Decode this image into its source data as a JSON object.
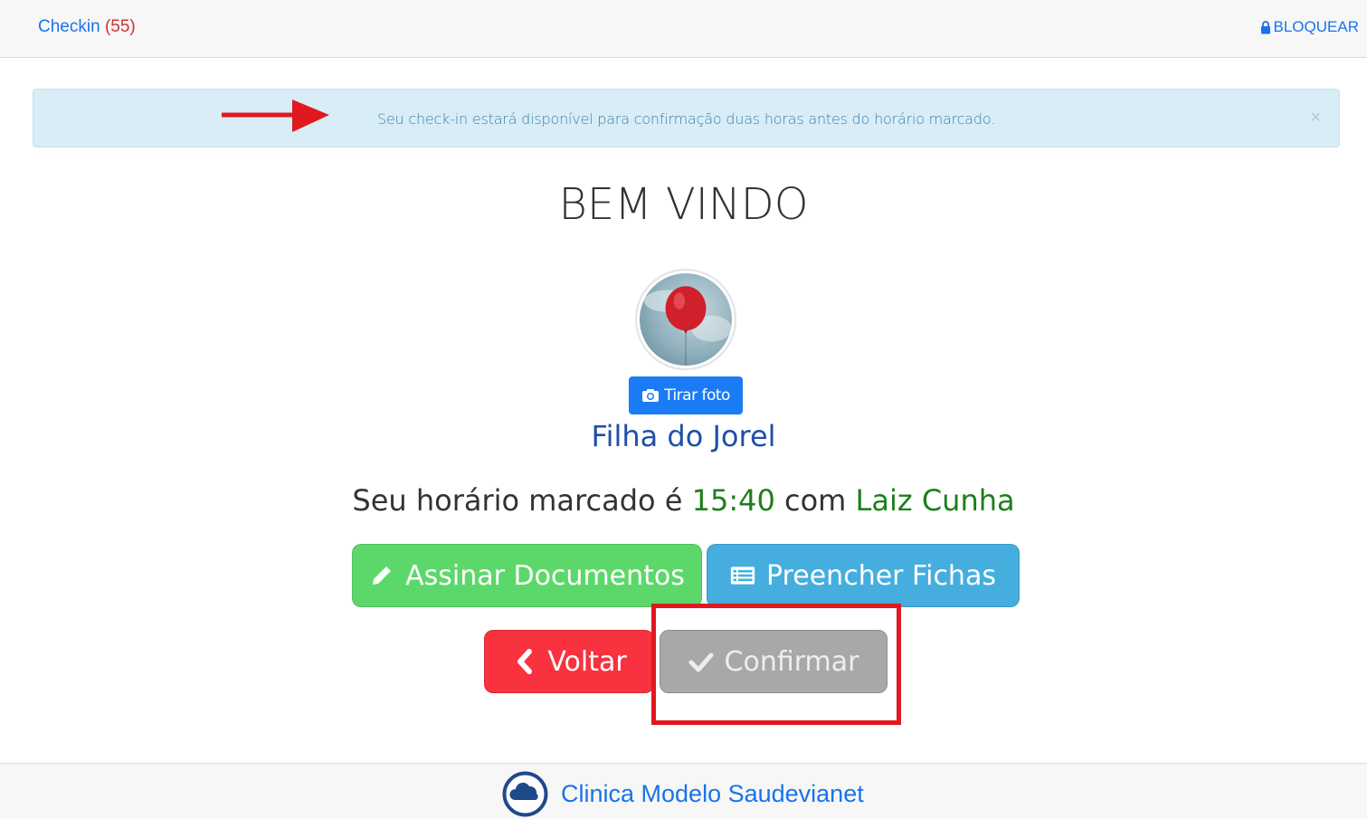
{
  "topbar": {
    "checkin_label": "Checkin",
    "checkin_count": "(55)",
    "lock_label": "BLOQUEAR"
  },
  "alert": {
    "message": "Seu check-in estará disponível para confirmação duas horas antes do horário marcado.",
    "close_glyph": "×"
  },
  "main": {
    "welcome": "BEM VINDO",
    "photo_button": "Tirar foto",
    "patient_name": "Filha do Jorel",
    "schedule_prefix": "Seu horário marcado é",
    "schedule_time": "15:40",
    "schedule_mid": "com",
    "schedule_doctor": "Laiz Cunha"
  },
  "actions": {
    "assinar": "Assinar Documentos",
    "preencher": "Preencher Fichas",
    "voltar": "Voltar",
    "confirmar": "Confirmar"
  },
  "footer": {
    "clinic_name": "Clinica Modelo Saudevianet"
  },
  "colors": {
    "link_blue": "#1a73e8",
    "alert_bg": "#d9edf7",
    "green_button": "#5cd86a",
    "blue_button": "#45aedf",
    "red_button": "#f8323f",
    "disabled_button": "#a8a8a8",
    "annotation_red": "#e0191f"
  },
  "icons": {
    "lock": "lock-icon",
    "camera": "camera-icon",
    "pencil": "pencil-icon",
    "list": "list-icon",
    "chevron": "chevron-left-icon",
    "check": "check-icon",
    "cloud_logo": "cloud-logo-icon"
  }
}
